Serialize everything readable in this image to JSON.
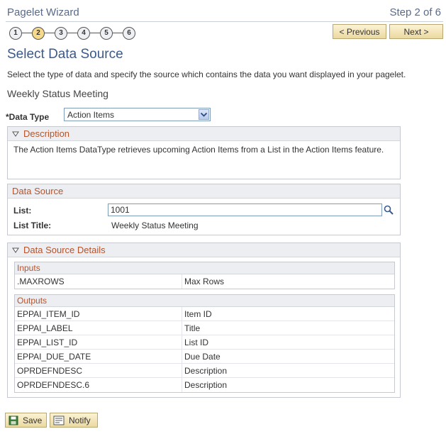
{
  "header": {
    "wizard_title": "Pagelet Wizard",
    "step_of": "Step 2 of 6"
  },
  "steps": {
    "items": [
      "1",
      "2",
      "3",
      "4",
      "5",
      "6"
    ],
    "current": "2"
  },
  "nav": {
    "previous_label": "< Previous",
    "next_label": "Next >"
  },
  "page": {
    "title": "Select Data Source",
    "instructions": "Select the type of data and specify the source which contains the data you want displayed in your pagelet.",
    "subtitle": "Weekly Status Meeting"
  },
  "data_type": {
    "label": "*Data Type",
    "selected": "Action Items"
  },
  "description": {
    "header": "Description",
    "text": "The Action Items DataType retrieves upcoming Action Items from a List in the Action Items feature."
  },
  "data_source": {
    "header": "Data Source",
    "list_label": "List:",
    "list_value": "1001",
    "list_title_label": "List Title:",
    "list_title_value": "Weekly Status Meeting"
  },
  "details": {
    "header": "Data Source Details",
    "inputs_header": "Inputs",
    "inputs": [
      {
        "name": ".MAXROWS",
        "label": "Max Rows"
      }
    ],
    "outputs_header": "Outputs",
    "outputs": [
      {
        "name": "EPPAI_ITEM_ID",
        "label": "Item ID"
      },
      {
        "name": "EPPAI_LABEL",
        "label": "Title"
      },
      {
        "name": "EPPAI_LIST_ID",
        "label": "List ID"
      },
      {
        "name": "EPPAI_DUE_DATE",
        "label": "Due Date"
      },
      {
        "name": "OPRDEFNDESC",
        "label": "Description"
      },
      {
        "name": "OPRDEFNDESC.6",
        "label": "Description"
      }
    ]
  },
  "footer": {
    "save_label": "Save",
    "notify_label": "Notify"
  },
  "colors": {
    "title_blue": "#3c5a8a",
    "section_header": "#b5532b",
    "button_gold": "#ecd9a0"
  }
}
